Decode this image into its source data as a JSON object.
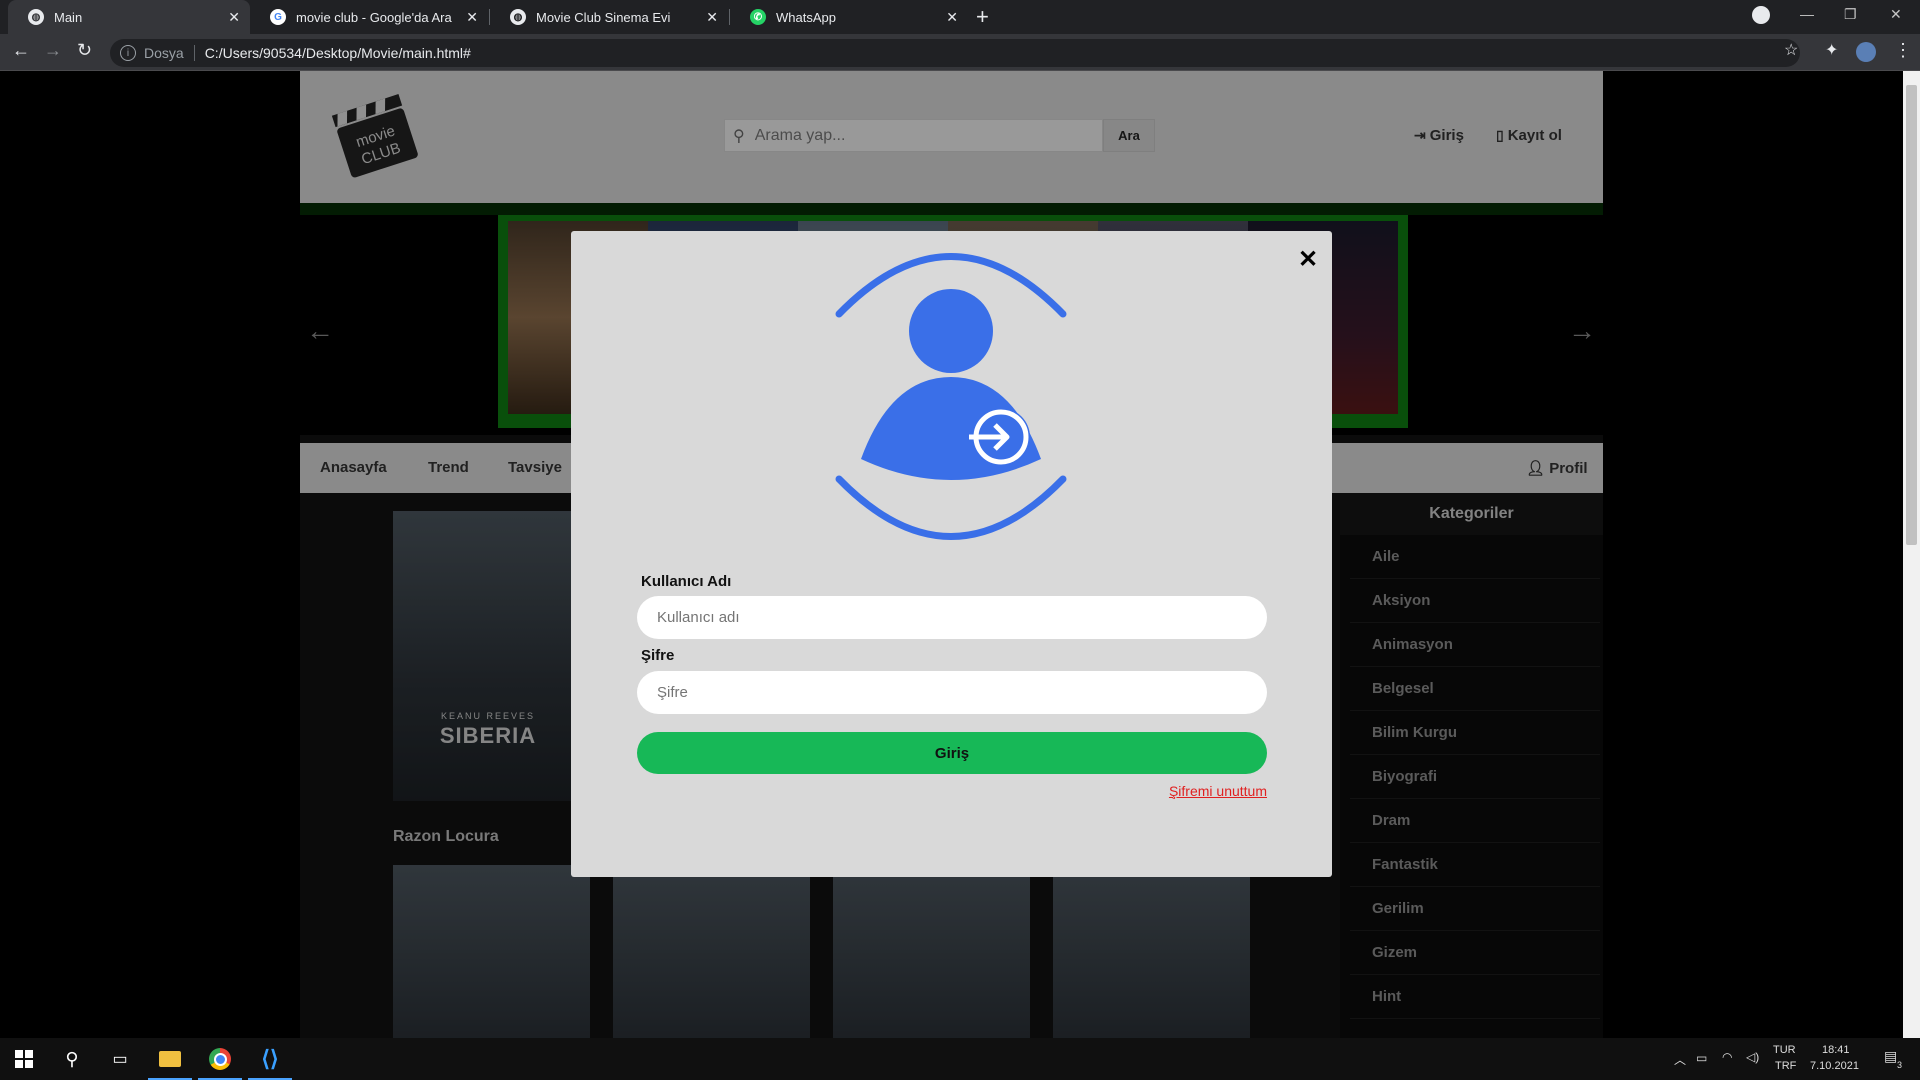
{
  "browser": {
    "tabs": [
      {
        "title": "Main",
        "icon": "globe-icon",
        "active": true
      },
      {
        "title": "movie club - Google'da Ara",
        "icon": "google-icon",
        "active": false
      },
      {
        "title": "Movie Club Sinema Evi",
        "icon": "globe-icon",
        "active": false
      },
      {
        "title": "WhatsApp",
        "icon": "whatsapp-icon",
        "active": false
      }
    ],
    "new_tab": "+",
    "address": {
      "protocol_label": "Dosya",
      "url": "C:/Users/90534/Desktop/Movie/main.html#"
    }
  },
  "site": {
    "logo_text": [
      "movie",
      "CLUB"
    ],
    "search": {
      "placeholder": "Arama yap...",
      "button": "Ara"
    },
    "header_links": {
      "login": "Giriş",
      "register": "Kayıt ol"
    },
    "menu": {
      "items": [
        "Anasayfa",
        "Trend",
        "Tavsiye"
      ],
      "profile": "Profil"
    },
    "movies": [
      {
        "title": "Razon Locura",
        "poster_text": "SIBERIA",
        "poster_subtext": "KEANU REEVES"
      }
    ],
    "categories": {
      "title": "Kategoriler",
      "items": [
        "Aile",
        "Aksiyon",
        "Animasyon",
        "Belgesel",
        "Bilim Kurgu",
        "Biyografi",
        "Dram",
        "Fantastik",
        "Gerilim",
        "Gizem",
        "Hint"
      ]
    }
  },
  "modal": {
    "close": "✕",
    "username_label": "Kullanıcı Adı",
    "username_placeholder": "Kullanıcı adı",
    "password_label": "Şifre",
    "password_placeholder": "Şifre",
    "login_button": "Giriş",
    "forgot_link": "Şifremi unuttum",
    "accent_color": "#3a6fe8",
    "button_color": "#17b857"
  },
  "taskbar": {
    "lang": [
      "TUR",
      "TRF"
    ],
    "time": "18:41",
    "date": "7.10.2021",
    "notifications": "3"
  }
}
